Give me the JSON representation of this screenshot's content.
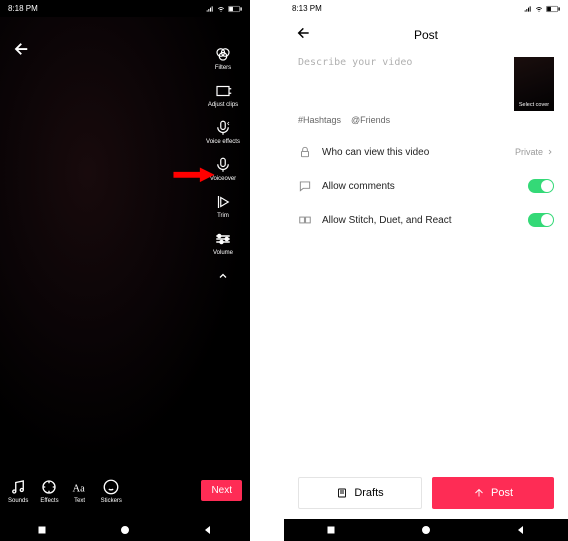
{
  "left": {
    "status_time": "8:18 PM",
    "side_tools": [
      {
        "name": "filters",
        "label": "Filters"
      },
      {
        "name": "adjust-clips",
        "label": "Adjust clips"
      },
      {
        "name": "voice-effects",
        "label": "Voice effects"
      },
      {
        "name": "voiceover",
        "label": "Voiceover"
      },
      {
        "name": "trim",
        "label": "Trim"
      },
      {
        "name": "volume",
        "label": "Volume"
      }
    ],
    "bottom_tools": [
      {
        "name": "sounds",
        "label": "Sounds"
      },
      {
        "name": "effects",
        "label": "Effects"
      },
      {
        "name": "text",
        "label": "Text"
      },
      {
        "name": "stickers",
        "label": "Stickers"
      }
    ],
    "next_label": "Next"
  },
  "right": {
    "status_time": "8:13 PM",
    "title": "Post",
    "placeholder": "Describe your video",
    "cover_label": "Select cover",
    "hashtags_label": "#Hashtags",
    "friends_label": "@Friends",
    "who_can_view": "Who can view this video",
    "who_value": "Private",
    "allow_comments": "Allow comments",
    "allow_stitch": "Allow Stitch, Duet, and React",
    "drafts_label": "Drafts",
    "post_label": "Post"
  }
}
